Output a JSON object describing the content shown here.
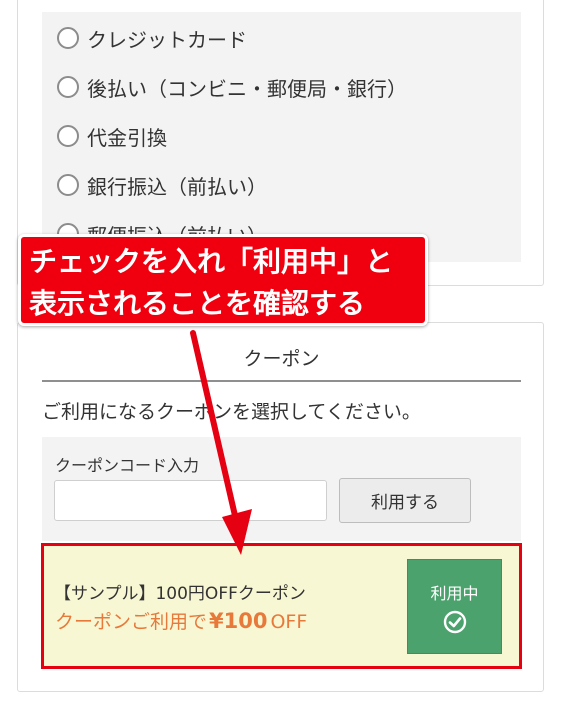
{
  "payment": {
    "options": [
      {
        "label": "クレジットカード"
      },
      {
        "label": "後払い（コンビニ・郵便局・銀行）"
      },
      {
        "label": "代金引換"
      },
      {
        "label": "銀行振込（前払い）"
      },
      {
        "label": "郵便振込（前払い）"
      }
    ]
  },
  "callout": {
    "line1": "チェックを入れ「利用中」と",
    "line2": "表示されることを確認する"
  },
  "coupon": {
    "title": "クーポン",
    "description": "ご利用になるクーポンを選択してください。",
    "code_label": "クーポンコード入力",
    "code_value": "",
    "apply_label": "利用する",
    "item": {
      "name": "【サンプル】100円OFFクーポン",
      "off_prefix": "クーポンご利用で",
      "off_amount": "¥100",
      "off_suffix": "OFF",
      "status_label": "利用中",
      "status_icon": "check-circle-icon"
    }
  },
  "colors": {
    "accent_red": "#e50012",
    "coupon_bg": "#f8f7d3",
    "inuse_green": "#4ba26c",
    "discount_orange": "#e7793b"
  }
}
